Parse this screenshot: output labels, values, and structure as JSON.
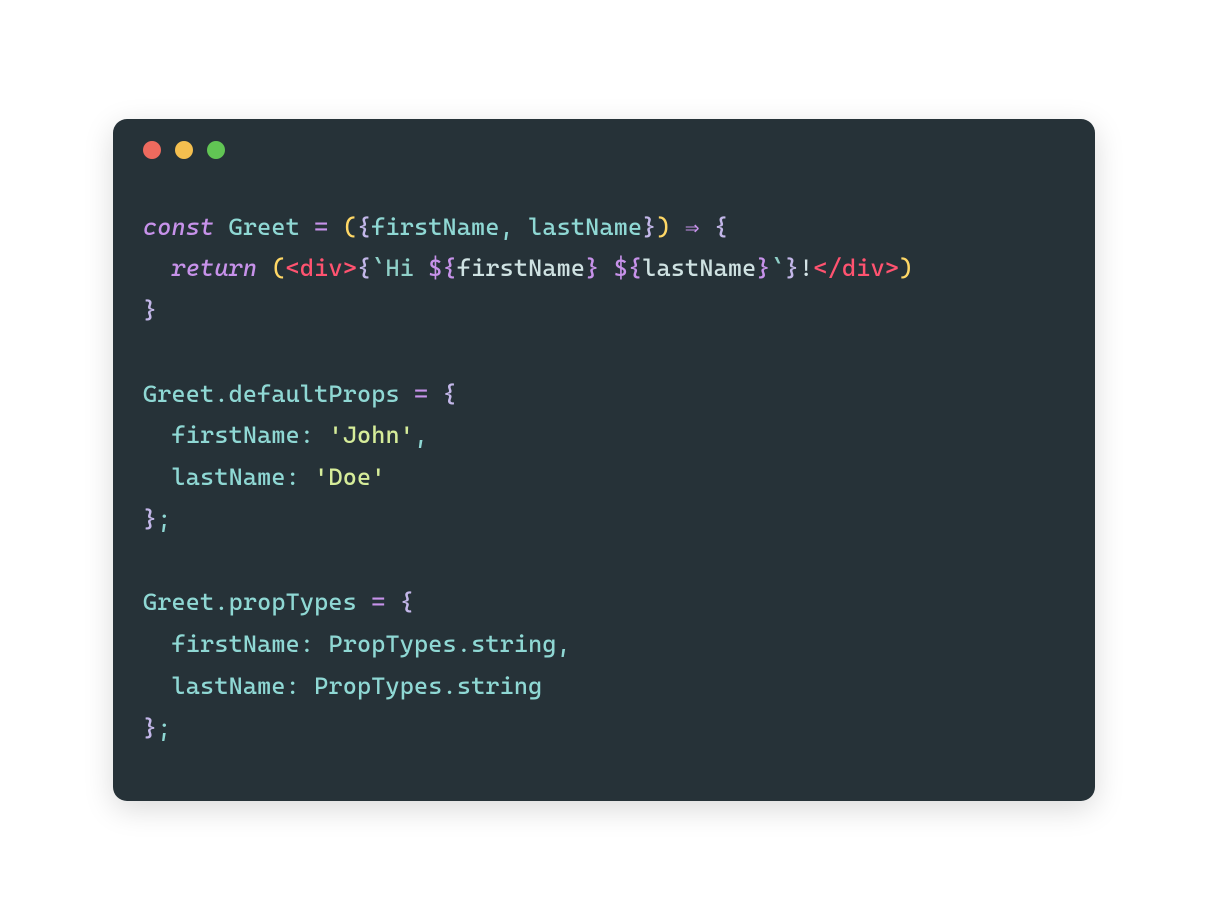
{
  "colors": {
    "background": "#263238",
    "dot_red": "#ed6a5e",
    "dot_yellow": "#f4bf4f",
    "dot_green": "#61c554"
  },
  "code": {
    "line1": {
      "kw_const": "const",
      "sp1": " ",
      "ident_greet": "Greet",
      "sp2": " ",
      "eq": "=",
      "sp3": " ",
      "lparen1": "(",
      "lbrace1": "{",
      "first": "firstName",
      "comma1": ",",
      "sp4": " ",
      "last": "lastName",
      "rbrace1": "}",
      "rparen1": ")",
      "sp5": " ",
      "arrow": "⇒",
      "sp6": " ",
      "lbrace2": "{"
    },
    "line2": {
      "indent": "  ",
      "kw_return": "return",
      "sp1": " ",
      "lparen": "(",
      "tag_open_lt": "<",
      "tag_open_name": "div",
      "tag_open_gt": ">",
      "jsx_lbrace": "{",
      "backtick1": "`",
      "lit1": "Hi ",
      "interp1_open": "${",
      "interp1_var": "firstName",
      "interp1_close": "}",
      "lit_space": " ",
      "interp2_open": "${",
      "interp2_var": "lastName",
      "interp2_close": "}",
      "backtick2": "`",
      "jsx_rbrace": "}",
      "bang": "!",
      "tag_close_lt": "<",
      "tag_close_slash": "/",
      "tag_close_name": "div",
      "tag_close_gt": ">",
      "rparen": ")"
    },
    "line3": {
      "rbrace": "}"
    },
    "blank1": "",
    "line5": {
      "ident": "Greet",
      "dot": ".",
      "prop": "defaultProps",
      "sp1": " ",
      "eq": "=",
      "sp2": " ",
      "lbrace": "{"
    },
    "line6": {
      "indent": "  ",
      "key": "firstName",
      "colon": ":",
      "sp": " ",
      "val": "'John'",
      "comma": ","
    },
    "line7": {
      "indent": "  ",
      "key": "lastName",
      "colon": ":",
      "sp": " ",
      "val": "'Doe'"
    },
    "line8": {
      "rbrace": "}",
      "semi": ";"
    },
    "blank2": "",
    "line10": {
      "ident": "Greet",
      "dot": ".",
      "prop": "propTypes",
      "sp1": " ",
      "eq": "=",
      "sp2": " ",
      "lbrace": "{"
    },
    "line11": {
      "indent": "  ",
      "key": "firstName",
      "colon": ":",
      "sp": " ",
      "obj": "PropTypes",
      "dot": ".",
      "member": "string",
      "comma": ","
    },
    "line12": {
      "indent": "  ",
      "key": "lastName",
      "colon": ":",
      "sp": " ",
      "obj": "PropTypes",
      "dot": ".",
      "member": "string"
    },
    "line13": {
      "rbrace": "}",
      "semi": ";"
    }
  }
}
